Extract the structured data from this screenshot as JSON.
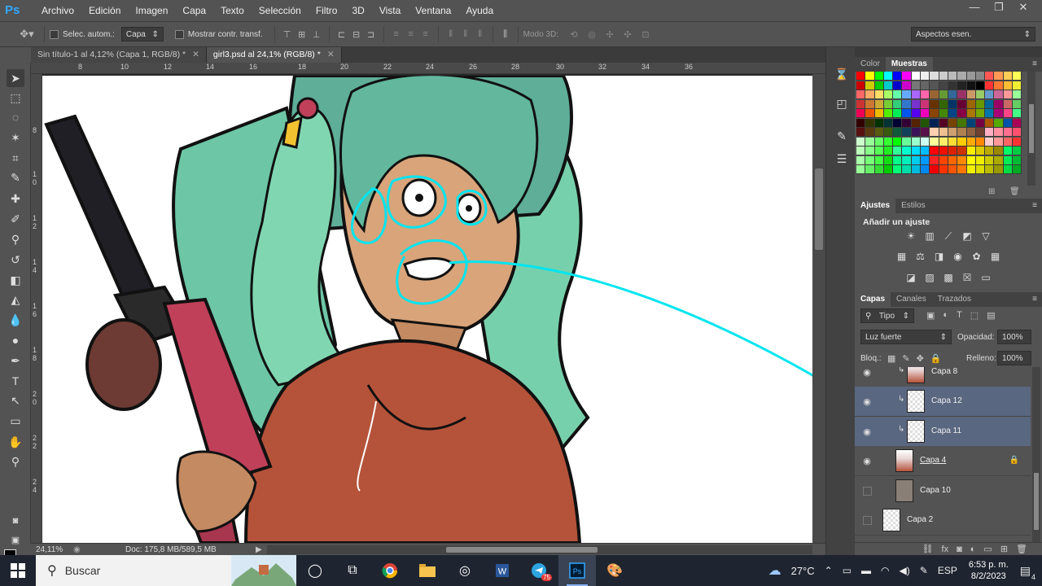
{
  "app": {
    "logo": "Ps"
  },
  "menu": [
    "Archivo",
    "Edición",
    "Imagen",
    "Capa",
    "Texto",
    "Selección",
    "Filtro",
    "3D",
    "Vista",
    "Ventana",
    "Ayuda"
  ],
  "window_controls": {
    "minimize": "—",
    "restore": "❐",
    "close": "✕"
  },
  "options": {
    "auto_select_label": "Selec. autom.:",
    "auto_select_value": "Capa",
    "show_transform_label": "Mostrar contr. transf.",
    "mode3d_label": "Modo 3D:",
    "workspace": "Aspectos esen."
  },
  "tabs": [
    {
      "label": "Sin título-1 al 4,12% (Capa 1, RGB/8) *",
      "active": false
    },
    {
      "label": "girl3.psd al 24,1% (RGB/8) *",
      "active": true
    }
  ],
  "ruler_top": [
    "8",
    "10",
    "12",
    "14",
    "16",
    "18",
    "20",
    "22",
    "24",
    "26",
    "28",
    "30",
    "32",
    "34",
    "36"
  ],
  "ruler_left": [
    "8",
    "1 0",
    "1 2",
    "1 4",
    "1 6",
    "1 8",
    "2 0",
    "2 2",
    "2 4"
  ],
  "status": {
    "zoom": "24,11%",
    "doc": "Doc: 175,8 MB/589,5 MB"
  },
  "panels": {
    "color_tabs": [
      "Color",
      "Muestras"
    ],
    "adjust_tabs": [
      "Ajustes",
      "Estilos"
    ],
    "adjust_title": "Añadir un ajuste",
    "layer_tabs": [
      "Capas",
      "Canales",
      "Trazados"
    ],
    "filter_kind": "Tipo",
    "blend_mode": "Luz fuerte",
    "opacity_label": "Opacidad:",
    "opacity_value": "100%",
    "lock_label": "Bloq.:",
    "fill_label": "Relleno:",
    "fill_value": "100%"
  },
  "layers": [
    {
      "name": "Capa 8",
      "visible": true,
      "selected": false,
      "clipped": true,
      "thumb": "art"
    },
    {
      "name": "Capa 12",
      "visible": true,
      "selected": true,
      "clipped": true,
      "thumb": "checker"
    },
    {
      "name": "Capa 11",
      "visible": true,
      "selected": true,
      "clipped": true,
      "thumb": "checker"
    },
    {
      "name": "Capa 4",
      "visible": true,
      "selected": false,
      "clipped": false,
      "thumb": "art",
      "locked": true
    },
    {
      "name": "Capa 10",
      "visible": false,
      "selected": false,
      "clipped": false,
      "thumb": "gray"
    },
    {
      "name": "Capa 2",
      "visible": false,
      "selected": false,
      "clipped": false,
      "thumb": "checker"
    }
  ],
  "taskbar": {
    "search_placeholder": "Buscar",
    "weather": "27°C",
    "lang": "ESP",
    "time": "6:53 p. m.",
    "date": "8/2/2023",
    "notif_badge": "75",
    "notifications": "4"
  },
  "colors": {
    "accent": "#31a8ff",
    "annotation": "#00e5f0",
    "selected_layer": "#5a6780"
  }
}
